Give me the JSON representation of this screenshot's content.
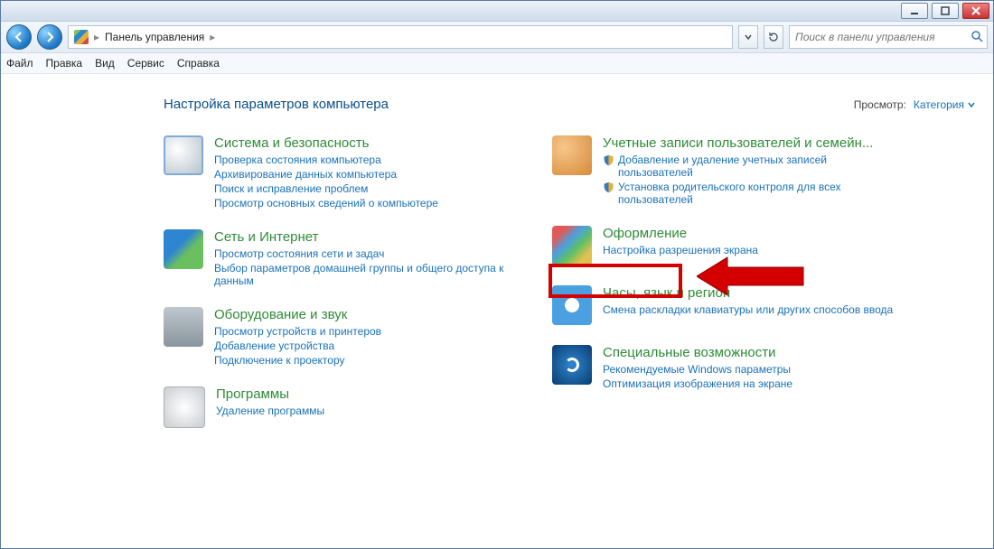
{
  "breadcrumb": {
    "root": "Панель управления"
  },
  "search": {
    "placeholder": "Поиск в панели управления"
  },
  "menu": {
    "file": "Файл",
    "edit": "Правка",
    "view": "Вид",
    "tools": "Сервис",
    "help": "Справка"
  },
  "page": {
    "title": "Настройка параметров компьютера",
    "view_label": "Просмотр:",
    "view_value": "Категория"
  },
  "left": [
    {
      "key": "system",
      "title": "Система и безопасность",
      "links": [
        {
          "text": "Проверка состояния компьютера"
        },
        {
          "text": "Архивирование данных компьютера"
        },
        {
          "text": "Поиск и исправление проблем"
        },
        {
          "text": "Просмотр основных сведений о компьютере"
        }
      ]
    },
    {
      "key": "net",
      "title": "Сеть и Интернет",
      "links": [
        {
          "text": "Просмотр состояния сети и задач"
        },
        {
          "text": "Выбор параметров домашней группы и общего доступа к данным"
        }
      ]
    },
    {
      "key": "hw",
      "title": "Оборудование и звук",
      "links": [
        {
          "text": "Просмотр устройств и принтеров"
        },
        {
          "text": "Добавление устройства"
        },
        {
          "text": "Подключение к проектору"
        }
      ]
    },
    {
      "key": "prog",
      "title": "Программы",
      "links": [
        {
          "text": "Удаление программы"
        }
      ]
    }
  ],
  "right": [
    {
      "key": "user",
      "title": "Учетные записи пользователей и семейн...",
      "links": [
        {
          "shield": true,
          "text": "Добавление и удаление учетных записей пользователей"
        },
        {
          "shield": true,
          "text": "Установка родительского контроля для всех пользователей"
        }
      ]
    },
    {
      "key": "appear",
      "title": "Оформление",
      "links": [
        {
          "text": "Настройка разрешения экрана"
        }
      ]
    },
    {
      "key": "clock",
      "title": "Часы, язык и регион",
      "links": [
        {
          "text": "Смена раскладки клавиатуры или других способов ввода"
        }
      ]
    },
    {
      "key": "access",
      "title": "Специальные возможности",
      "links": [
        {
          "text": "Рекомендуемые Windows параметры"
        },
        {
          "text": "Оптимизация изображения на экране"
        }
      ]
    }
  ]
}
